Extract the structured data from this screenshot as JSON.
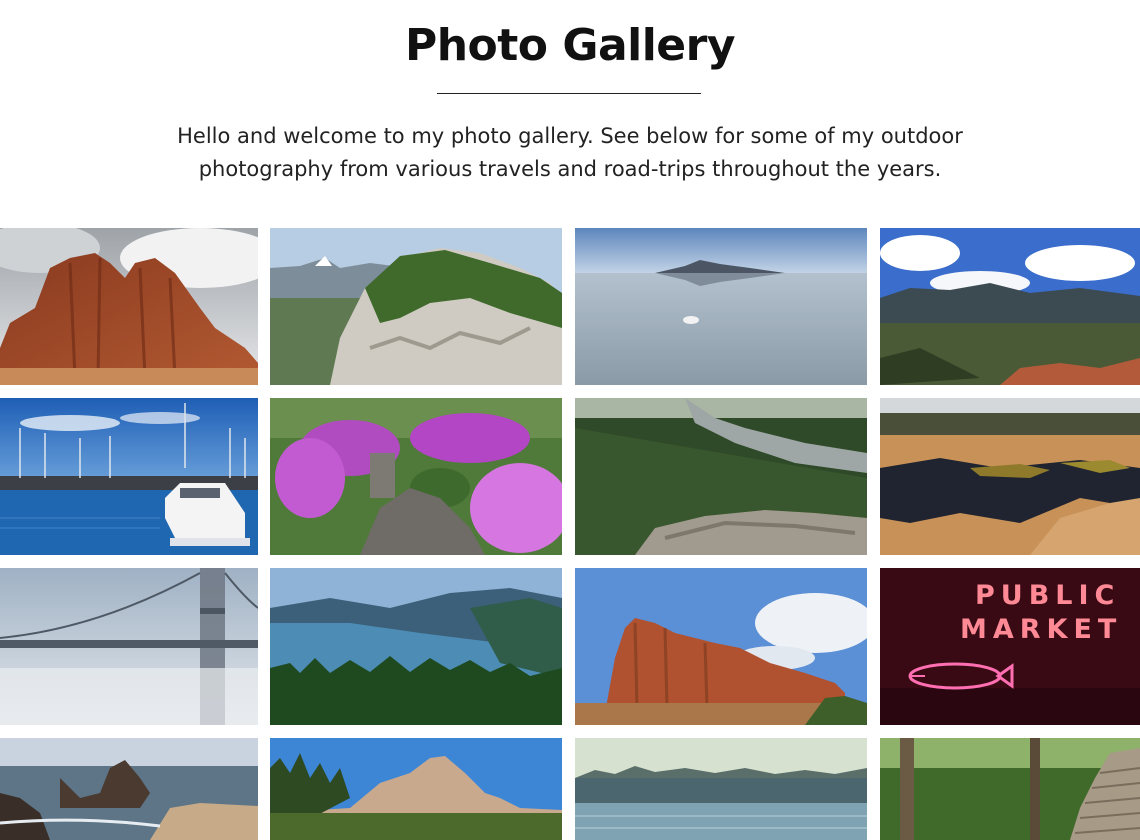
{
  "header": {
    "title": "Photo Gallery",
    "intro_line1": "Hello and welcome to my photo gallery. See below for some of my outdoor",
    "intro_line2": "photography from various travels and road-trips throughout the years."
  },
  "gallery": {
    "photos": [
      {
        "subject": "red rock formation under cloudy sky"
      },
      {
        "subject": "rocky forested summit with snowy peak"
      },
      {
        "subject": "salt flats reflecting mountains"
      },
      {
        "subject": "red rock park with mountains and clouds"
      },
      {
        "subject": "marina with white boat"
      },
      {
        "subject": "garden with purple rhododendrons"
      },
      {
        "subject": "river through forest from cliff"
      },
      {
        "subject": "tidal pools on rock plain"
      },
      {
        "subject": "suspension bridge in fog"
      },
      {
        "subject": "gorge with river and forest"
      },
      {
        "subject": "red rock butte in desert"
      },
      {
        "subject": "public market neon sign",
        "sign_line1": "PUBLIC",
        "sign_line2": "MARKET"
      },
      {
        "subject": "rocky beach with sea stacks"
      },
      {
        "subject": "flatiron rock formations"
      },
      {
        "subject": "city waterfront across river"
      },
      {
        "subject": "forest trail with wooden stairs"
      }
    ]
  },
  "colors": {
    "text": "#111111",
    "background": "#ffffff"
  }
}
